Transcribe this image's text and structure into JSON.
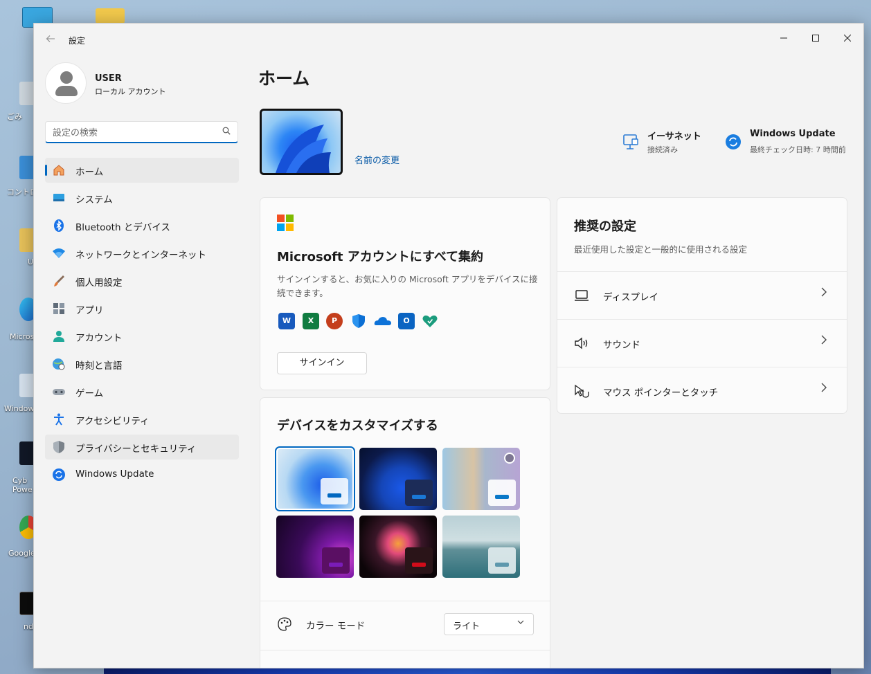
{
  "window": {
    "app_title": "設定"
  },
  "desktop": {
    "icon_labels": [
      "ごみ",
      "コントロー",
      "U",
      "Micros",
      "Window",
      "Cyb Powe",
      "Google",
      "nd"
    ]
  },
  "profile": {
    "name": "USER",
    "account_type": "ローカル アカウント"
  },
  "search": {
    "placeholder": "設定の検索"
  },
  "nav": [
    {
      "label": "ホーム",
      "icon": "home-icon"
    },
    {
      "label": "システム",
      "icon": "system-icon"
    },
    {
      "label": "Bluetooth とデバイス",
      "icon": "bluetooth-icon"
    },
    {
      "label": "ネットワークとインターネット",
      "icon": "wifi-icon"
    },
    {
      "label": "個人用設定",
      "icon": "brush-icon"
    },
    {
      "label": "アプリ",
      "icon": "apps-icon"
    },
    {
      "label": "アカウント",
      "icon": "account-icon"
    },
    {
      "label": "時刻と言語",
      "icon": "globe-clock-icon"
    },
    {
      "label": "ゲーム",
      "icon": "gamepad-icon"
    },
    {
      "label": "アクセシビリティ",
      "icon": "accessibility-icon"
    },
    {
      "label": "プライバシーとセキュリティ",
      "icon": "shield-icon"
    },
    {
      "label": "Windows Update",
      "icon": "update-icon"
    }
  ],
  "main": {
    "title": "ホーム",
    "rename_link": "名前の変更",
    "ethernet": {
      "title": "イーサネット",
      "status": "接続済み"
    },
    "windows_update": {
      "title": "Windows Update",
      "status": "最終チェック日時: 7 時間前"
    }
  },
  "ms_account": {
    "title": "Microsoft アカウントにすべて集約",
    "description": "サインインすると、お気に入りの Microsoft アプリをデバイスに接続できます。",
    "apps": [
      "W",
      "X",
      "P",
      "",
      "",
      "O",
      ""
    ],
    "signin_label": "サインイン"
  },
  "recommended": {
    "title": "推奨の設定",
    "subtitle": "最近使用した設定と一般的に使用される設定",
    "items": [
      {
        "label": "ディスプレイ",
        "icon": "display-icon"
      },
      {
        "label": "サウンド",
        "icon": "speaker-icon"
      },
      {
        "label": "マウス ポインターとタッチ",
        "icon": "pointer-touch-icon"
      }
    ]
  },
  "customize": {
    "title": "デバイスをカスタマイズする",
    "color_mode_label": "カラー モード",
    "color_mode_value": "ライト"
  },
  "colors": {
    "accent": "#0067c0",
    "window_bg": "#f3f3f3",
    "card_bg": "#fbfbfb"
  }
}
